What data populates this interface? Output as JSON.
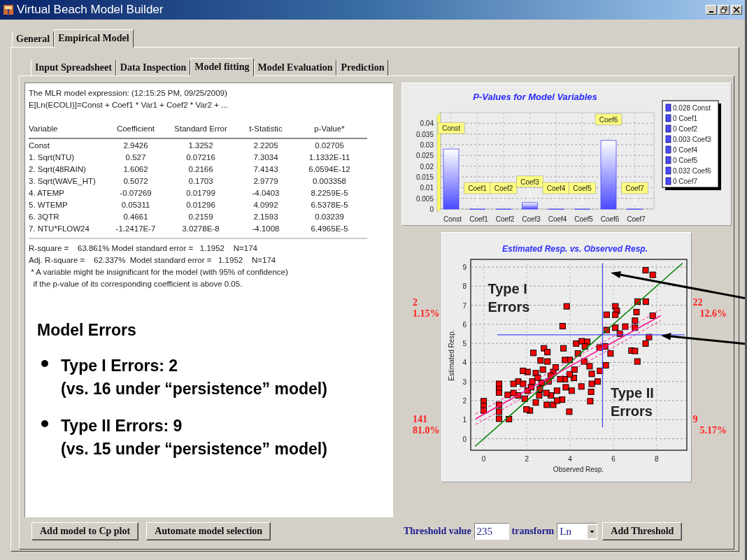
{
  "window": {
    "title": "Virtual Beach Model Builder"
  },
  "main_tabs": [
    {
      "label": "General",
      "selected": false
    },
    {
      "label": "Empirical Model",
      "selected": true
    }
  ],
  "sub_tabs": [
    {
      "label": "Input Spreadsheet",
      "selected": false
    },
    {
      "label": "Data Inspection",
      "selected": false
    },
    {
      "label": "Model fitting",
      "selected": true
    },
    {
      "label": "Model Evaluation",
      "selected": false
    },
    {
      "label": "Prediction",
      "selected": false
    }
  ],
  "model_output": {
    "header_lines": [
      "The MLR model expression: (12:15:25 PM, 09/25/2009)",
      "E[Ln(ECOLI)]=Const + Coef1 * Var1 + Coef2 * Var2 + ..."
    ],
    "columns": [
      "Variable",
      "Coefficient",
      "Standard Error",
      "t-Statistic",
      "p-Value*"
    ],
    "rows": [
      [
        "Const",
        "2.9426",
        "1.3252",
        "2.2205",
        "0.02705"
      ],
      [
        "1. Sqrt(NTU)",
        "0.527",
        "0.07216",
        "7.3034",
        "1.1332E-11"
      ],
      [
        "2. Sqrt(48RAIN)",
        "1.6062",
        "0.2166",
        "7.4143",
        "6.0594E-12"
      ],
      [
        "3. Sqrt(WAVE_HT)",
        "0.5072",
        "0.1703",
        "2.9779",
        "0.003358"
      ],
      [
        "4. ATEMP",
        "-0.07269",
        "0.01799",
        "-4.0403",
        "8.2259E-5"
      ],
      [
        "5. WTEMP",
        "0.05311",
        "0.01296",
        "4.0992",
        "6.5378E-5"
      ],
      [
        "6. 3QTR",
        "0.4661",
        "0.2159",
        "2.1593",
        "0.03239"
      ],
      [
        "7. NTU*FLOW24",
        "-1.2417E-7",
        "3.0278E-8",
        "-4.1008",
        "6.4965E-5"
      ]
    ],
    "summary_lines": [
      "R-square =    63.861% Model standard error =   1.1952    N=174",
      "Adj. R-square =    62.337%  Model standard error =   1.1952    N=174",
      " * A variable might be insignificant for the model (with 95% of confidence)",
      "  if the p-value of its corresponding coefficient is above 0.05."
    ]
  },
  "model_errors": {
    "title": "Model Errors",
    "items": [
      {
        "label": "Type I Errors: 2",
        "note": "(vs. 16 under “persistence” model)"
      },
      {
        "label": "Type II Errors: 9",
        "note": "(vs. 15 under “persistence” model)"
      }
    ]
  },
  "pvalue_chart": {
    "legend": [
      "0.028 Const",
      "0 Coef1",
      "0 Coef2",
      "0.003 Coef3",
      "0 Coef4",
      "0 Coef5",
      "0.032 Coef6",
      "0 Coef7"
    ],
    "chart_data": {
      "type": "bar",
      "title": "P-Values for Model Variables",
      "categories": [
        "Const",
        "Coef1",
        "Coef2",
        "Coef3",
        "Coef4",
        "Coef5",
        "Coef6",
        "Coef7"
      ],
      "series": [
        {
          "color": "#4a4aff",
          "values": [
            0.028,
            0,
            0,
            0.003,
            0,
            0,
            0.032,
            0
          ]
        }
      ],
      "ylim": [
        0,
        0.045
      ],
      "yticks": [
        0,
        0.005,
        0.01,
        0.015,
        0.02,
        0.025,
        0.03,
        0.035,
        0.04
      ],
      "grid": true,
      "value_labels": [
        "Const",
        "Coef1",
        "Coef2",
        "Coef3",
        "Coef4",
        "Coef5",
        "Coef6",
        "Coef7"
      ]
    }
  },
  "scatter": {
    "left_counts": [
      {
        "count": "2",
        "percent": "1.15%"
      },
      {
        "count": "141",
        "percent": "81.0%"
      }
    ],
    "right_counts": [
      {
        "count": "22",
        "percent": "12.6%"
      },
      {
        "count": "9",
        "percent": "5.17%"
      }
    ],
    "chart_data": {
      "type": "scatter",
      "title": "Estimated Resp. vs. Observed Resp.",
      "xlabel": "Observed Resp.",
      "ylabel": "Estimated Resp.",
      "xlim": [
        -0.6,
        9.4
      ],
      "ylim": [
        -0.6,
        9.4
      ],
      "xticks": [
        0,
        2,
        4,
        6,
        8
      ],
      "yticks": [
        0,
        1,
        2,
        3,
        4,
        5,
        6,
        7,
        8,
        9
      ],
      "grid": true,
      "x": [
        7.49,
        7.82,
        3.84,
        3.65,
        5.69,
        6.09,
        6.16,
        6.09,
        7.12,
        7.5,
        7.07,
        7.82,
        7.0,
        7.0,
        6.55,
        6.09,
        5.69,
        6.3,
        7.65,
        7.49,
        6.84,
        7.0,
        7.11,
        5.87,
        5.62,
        5.36,
        5.65,
        5.38,
        5.27,
        5.0,
        4.9,
        5.0,
        4.97,
        4.93,
        4.52,
        4.28,
        4.54,
        4.79,
        4.68,
        4.36,
        4.65,
        3.98,
        3.76,
        3.69,
        4.2,
        4.17,
        4.07,
        3.8,
        3.96,
        3.63,
        3.39,
        3.11,
        3.22,
        2.92,
        2.79,
        2.95,
        2.3,
        2.63,
        2.95,
        2.74,
        3.22,
        2.41,
        2.03,
        1.82,
        1.6,
        1.38,
        1.82,
        2.03,
        1.6,
        1.38,
        1.11,
        2.41,
        2.14,
        1.98,
        2.57,
        2.68,
        2.25,
        1.17,
        0.71,
        0.71,
        0.71,
        0.71,
        0.71,
        0.71,
        0,
        0,
        0,
        3.76,
        3.98,
        3.54,
        3.33,
        2.2,
        2.5,
        3.0,
        2.9,
        1.9,
        3.4,
        2.6,
        3.1
      ],
      "series": [
        {
          "color": "#ff0000",
          "values": [
            8.83,
            8.59,
            6.94,
            5.9,
            6.5,
            6.94,
            6.7,
            6.5,
            7.19,
            7.19,
            6.64,
            6.45,
            6.19,
            5.82,
            5.88,
            5.82,
            5.7,
            5.51,
            5.33,
            4.99,
            4.62,
            4.6,
            4.05,
            4.47,
            4.84,
            4.78,
            3.85,
            3.56,
            3.0,
            3.4,
            3.8,
            2.88,
            2.46,
            1.97,
            2.74,
            4.99,
            5.11,
            5.08,
            4.84,
            4.47,
            4.05,
            4.13,
            4.13,
            4.74,
            3.62,
            3.19,
            2.52,
            2.7,
            1.42,
            2.05,
            2.52,
            2.27,
            1.78,
            1.78,
            4.74,
            4.54,
            4.5,
            4.1,
            4.05,
            3.62,
            3.5,
            3.44,
            3.5,
            3.56,
            3.0,
            2.88,
            2.88,
            2.52,
            2.27,
            2.4,
            2.3,
            1.9,
            1.48,
            1.54,
            2.27,
            2.94,
            3.0,
            1.03,
            1.05,
            1.42,
            1.78,
            2.42,
            2.7,
            2.88,
            1.97,
            1.72,
            1.48,
            3.12,
            3.38,
            3.12,
            3.74,
            2.7,
            3.2,
            3.0,
            2.4,
            2.1,
            2.0,
            2.6,
            3.3
          ]
        },
        {
          "type": "line",
          "color": "#008000",
          "x": [
            -0.4,
            9.2
          ],
          "values": [
            -0.4,
            9.2
          ]
        },
        {
          "type": "line",
          "line_style": "dashed",
          "color": "#ff1493",
          "x": [
            -0.37,
            8.19
          ],
          "values": [
            1.3,
            6.76
          ]
        },
        {
          "type": "line",
          "line_style": "dashed",
          "color": "#ff1493",
          "x": [
            -0.37,
            8.19
          ],
          "values": [
            0.75,
            6.19
          ]
        },
        {
          "type": "line",
          "color": "#ff1493",
          "x": [
            -0.37,
            8.19
          ],
          "values": [
            1.05,
            6.45
          ]
        }
      ],
      "ref_lines": [
        {
          "axis": "x",
          "value": 5.5,
          "color": "#4a4aff"
        },
        {
          "axis": "y",
          "value": 5.45,
          "color": "#4a4aff"
        }
      ],
      "annotations": [
        "Type I Errors",
        "Type II Errors"
      ]
    }
  },
  "left_buttons": [
    "Add model to Cp plot",
    "Automate model selection"
  ],
  "threshold": {
    "label": "Threshold value",
    "value": "235",
    "transform_label": "transform",
    "transform": "Ln",
    "button": "Add Threshold"
  }
}
